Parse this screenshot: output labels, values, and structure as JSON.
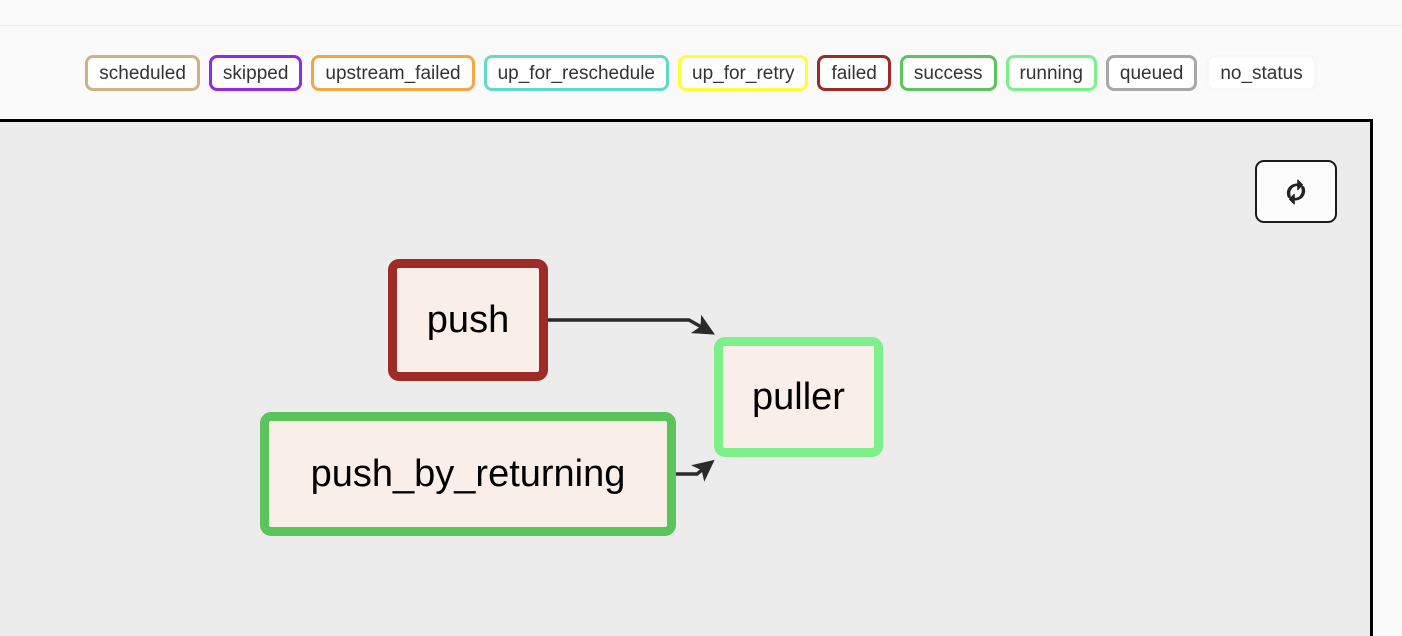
{
  "legend": {
    "items": [
      {
        "label": "scheduled",
        "color": "#d0b287"
      },
      {
        "label": "skipped",
        "color": "#8f2be3"
      },
      {
        "label": "upstream_failed",
        "color": "#f5a742"
      },
      {
        "label": "up_for_reschedule",
        "color": "#63d8cd"
      },
      {
        "label": "up_for_retry",
        "color": "#fdfd3c"
      },
      {
        "label": "failed",
        "color": "#9e2b25"
      },
      {
        "label": "success",
        "color": "#5bc45b"
      },
      {
        "label": "running",
        "color": "#7ef08a"
      },
      {
        "label": "queued",
        "color": "#a8a8a8"
      },
      {
        "label": "no_status",
        "color": "#f7f7f7"
      }
    ]
  },
  "graph": {
    "background_color": "#ececec",
    "node_fill_color": "#faeee9",
    "refresh_button": {
      "icon": "refresh-icon",
      "title": "Refresh"
    },
    "nodes": [
      {
        "id": "push",
        "label": "push",
        "status": "failed",
        "border_color": "#9e2b25"
      },
      {
        "id": "puller",
        "label": "puller",
        "status": "running",
        "border_color": "#7ef08a"
      },
      {
        "id": "push_by_returning",
        "label": "push_by_returning",
        "status": "success",
        "border_color": "#5bc45b"
      }
    ],
    "edges": [
      {
        "from": "push",
        "to": "puller"
      },
      {
        "from": "push_by_returning",
        "to": "puller"
      }
    ]
  }
}
